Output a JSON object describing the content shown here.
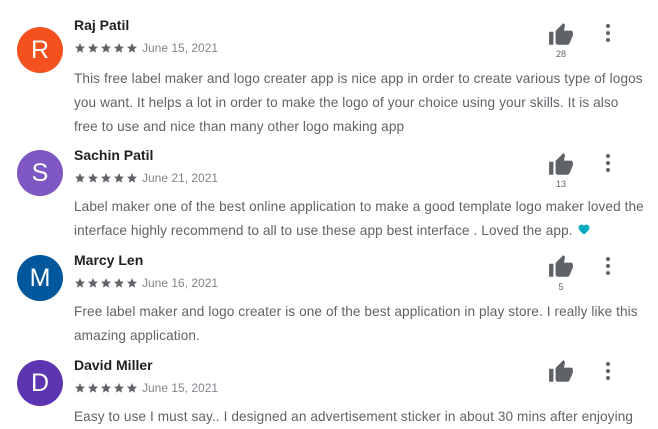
{
  "reviews": [
    {
      "initial": "R",
      "avatar_color": "#f4511e",
      "name": "Raj Patil",
      "rating": 5,
      "date": "June 15, 2021",
      "text": "This free label maker and logo creater app is nice app in order to create various type of logos you want. It helps a lot in order to make the logo of your choice using your skills. It is also free to use and nice than many other logo making app",
      "likes": "28"
    },
    {
      "initial": "S",
      "avatar_color": "#7e57c2",
      "name": "Sachin Patil",
      "rating": 5,
      "date": "June 21, 2021",
      "text": "Label maker one of the best online application to make a good template logo maker loved the interface highly recommend to all to use these app best interface . Loved the app.",
      "emoji": "heart-icon",
      "likes": "13"
    },
    {
      "initial": "M",
      "avatar_color": "#01579b",
      "name": "Marcy Len",
      "rating": 5,
      "date": "June 16, 2021",
      "text": "Free label maker and logo creater is one of the best application in play store. I really like this amazing application.",
      "likes": "5"
    },
    {
      "initial": "D",
      "avatar_color": "#5e35b1",
      "name": "David Miller",
      "rating": 5,
      "date": "June 15, 2021",
      "text": "Easy to use I must say.. I designed an advertisement sticker in about 30 mins after enjoying",
      "likes": ""
    }
  ],
  "colors": {
    "star": "#5f6368",
    "heart": "#00acc1",
    "icon": "#5f6368"
  }
}
